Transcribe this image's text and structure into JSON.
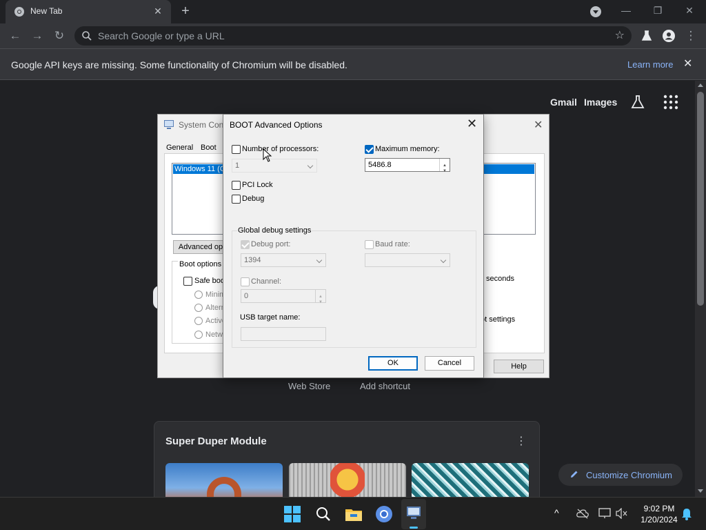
{
  "browser": {
    "tab_title": "New Tab",
    "omnibox_placeholder": "Search Google or type a URL",
    "infobar_message": "Google API keys are missing. Some functionality of Chromium will be disabled.",
    "infobar_link": "Learn more"
  },
  "ntp": {
    "gmail": "Gmail",
    "images": "Images",
    "shortcuts": [
      "Web Store",
      "Add shortcut"
    ],
    "module_title": "Super Duper Module",
    "customize": "Customize Chromium"
  },
  "msconfig": {
    "title": "System Conf",
    "tabs": [
      "General",
      "Boot"
    ],
    "os_entry": "Windows 11 (C",
    "advanced_button": "Advanced op",
    "boot_options_label": "Boot options",
    "safe_boot": "Safe boo",
    "radios": [
      "Minima",
      "Altern",
      "Active",
      "Netwo"
    ],
    "seconds": "seconds",
    "boot_settings": "ot settings",
    "help_button": "Help"
  },
  "dialog": {
    "title": "BOOT Advanced Options",
    "num_processors_label": "Number of processors:",
    "num_processors_value": "1",
    "num_processors_checked": false,
    "max_memory_label": "Maximum memory:",
    "max_memory_value": "5486.8",
    "max_memory_checked": true,
    "pci_lock_label": "PCI Lock",
    "debug_label": "Debug",
    "global_debug_label": "Global debug settings",
    "debug_port_label": "Debug port:",
    "debug_port_value": "1394",
    "baud_rate_label": "Baud rate:",
    "baud_rate_value": "",
    "channel_label": "Channel:",
    "channel_value": "0",
    "usb_target_label": "USB target name:",
    "usb_target_value": "",
    "ok_button": "OK",
    "cancel_button": "Cancel"
  },
  "taskbar": {
    "time": "9:02 PM",
    "date": "1/20/2024"
  },
  "colors": {
    "accent": "#0067c0",
    "link": "#8ab4f8",
    "chrome_bg": "#202124"
  }
}
